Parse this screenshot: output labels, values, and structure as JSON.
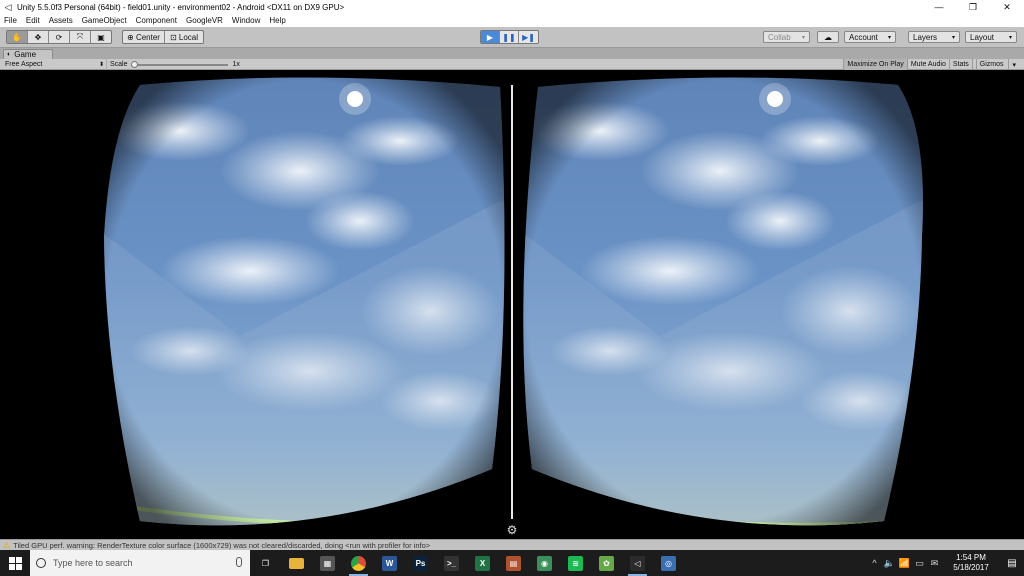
{
  "window": {
    "title": "Unity 5.5.0f3 Personal (64bit) - field01.unity - environment02 - Android <DX11 on DX9 GPU>",
    "controls": [
      "—",
      "❐",
      "✕"
    ]
  },
  "menu": [
    "File",
    "Edit",
    "Assets",
    "GameObject",
    "Component",
    "GoogleVR",
    "Window",
    "Help"
  ],
  "toolbar": {
    "tools": [
      "✋",
      "✥",
      "⟳",
      "⤧",
      "▣"
    ],
    "pivot": [
      "Center",
      "Local"
    ],
    "play": [
      "▶",
      "❚❚",
      "▶❚"
    ],
    "collab": "Collab",
    "cloud": "☁",
    "account": "Account",
    "layers": "Layers",
    "layout": "Layout"
  },
  "tab": {
    "label": "Game",
    "icon": "◐"
  },
  "game_bar": {
    "aspect": "Free Aspect",
    "scale_label": "Scale",
    "scale_value": "1x",
    "buttons": [
      "Maximize On Play",
      "Mute Audio",
      "Stats",
      "Gizmos"
    ],
    "gizmos_arrow": "▾"
  },
  "status": {
    "message": "Tiled GPU perf. warning: RenderTexture color surface  (1600x729) was not cleared/discarded, doing <run with profiler for info>"
  },
  "taskbar": {
    "search_placeholder": "Type here to search",
    "apps": [
      {
        "name": "task-view",
        "glyph": "❐",
        "color": "#1c1c1c",
        "running": false
      },
      {
        "name": "file-explorer",
        "glyph": "",
        "color": "#e8b33a",
        "running": false
      },
      {
        "name": "calculator",
        "glyph": "▦",
        "color": "#555555",
        "running": false
      },
      {
        "name": "chrome",
        "glyph": "",
        "color": "#e04a3a",
        "running": true
      },
      {
        "name": "word",
        "glyph": "W",
        "color": "#2b5797",
        "running": false
      },
      {
        "name": "photoshop",
        "glyph": "Ps",
        "color": "#0b2238",
        "running": false
      },
      {
        "name": "cmd",
        "glyph": ">_",
        "color": "#333333",
        "running": false
      },
      {
        "name": "excel",
        "glyph": "X",
        "color": "#217346",
        "running": false
      },
      {
        "name": "app-orange",
        "glyph": "▤",
        "color": "#b0522e",
        "running": false
      },
      {
        "name": "android-studio",
        "glyph": "◉",
        "color": "#3a8f5a",
        "running": false
      },
      {
        "name": "spotify",
        "glyph": "≋",
        "color": "#1db954",
        "running": false
      },
      {
        "name": "app-green",
        "glyph": "✿",
        "color": "#66a84a",
        "running": false
      },
      {
        "name": "unity",
        "glyph": "◁",
        "color": "#2b2b2b",
        "running": true
      },
      {
        "name": "app-blue",
        "glyph": "◎",
        "color": "#3a6fb0",
        "running": false
      }
    ],
    "tray": [
      "^",
      "🔈",
      "📶",
      "▭",
      "✉"
    ],
    "time": "1:54 PM",
    "date": "5/18/2017",
    "notification": "▤"
  }
}
